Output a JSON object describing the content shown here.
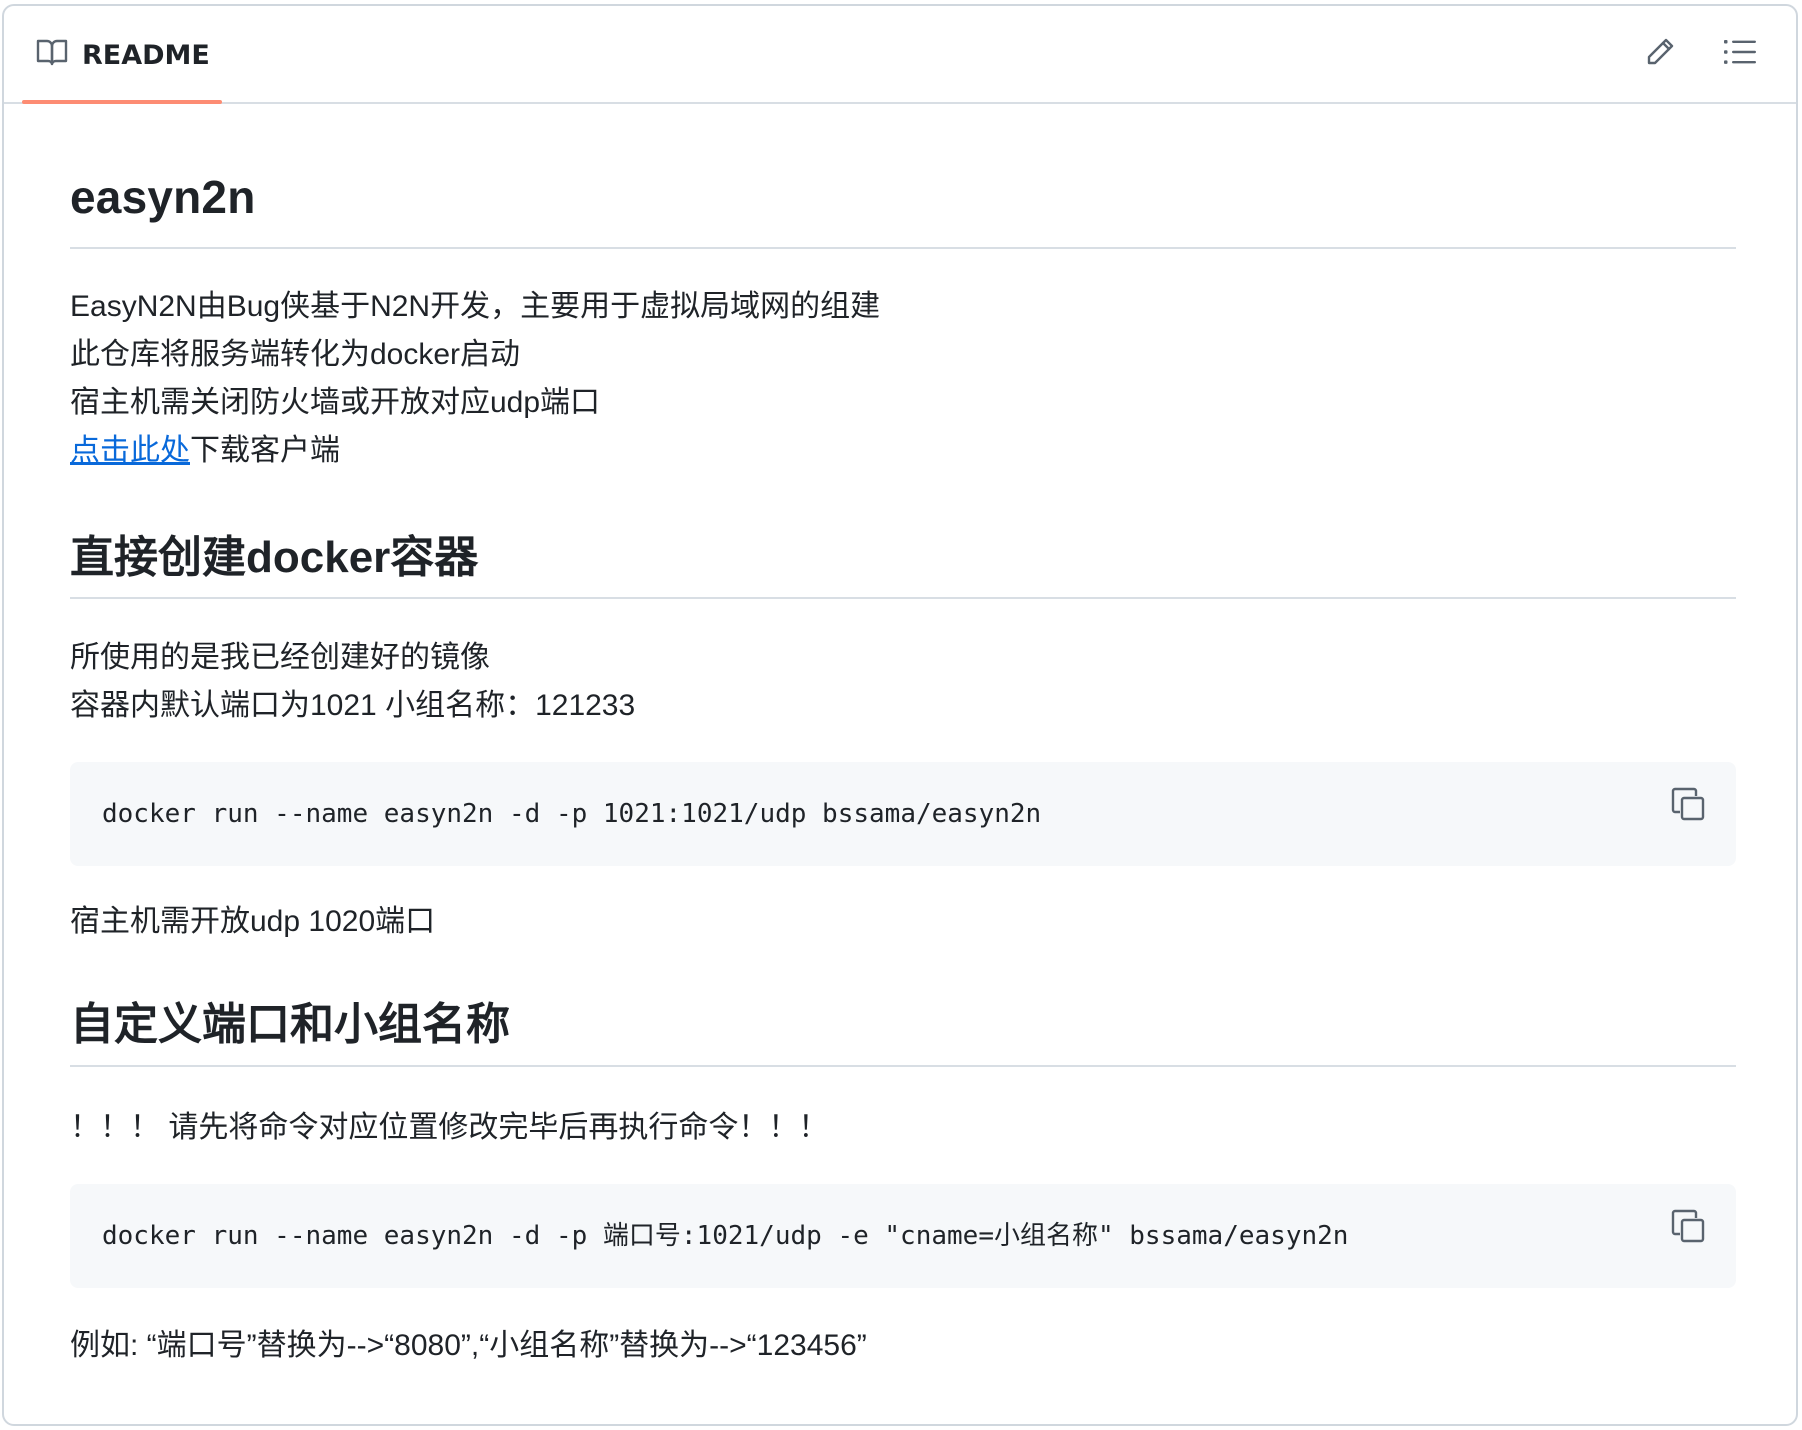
{
  "header": {
    "tab_label": "README"
  },
  "readme": {
    "title": "easyn2n",
    "intro_lines": [
      "EasyN2N由Bug侠基于N2N开发，主要用于虚拟局域网的组建",
      "此仓库将服务端转化为docker启动",
      "宿主机需关闭防火墙或开放对应udp端口"
    ],
    "download": {
      "link_text": "点击此处",
      "suffix": "下载客户端"
    },
    "section1": {
      "heading": "直接创建docker容器",
      "lines": [
        "所使用的是我已经创建好的镜像",
        "容器内默认端口为1021 小组名称：121233"
      ],
      "code": "docker run --name easyn2n -d -p 1021:1021/udp bssama/easyn2n",
      "note": "宿主机需开放udp 1020端口"
    },
    "section2": {
      "heading": "自定义端口和小组名称",
      "warning": "！！！ 请先将命令对应位置修改完毕后再执行命令！！！",
      "code": "docker run --name easyn2n -d -p 端口号:1021/udp -e \"cname=小组名称\" bssama/easyn2n",
      "example": "例如: “端口号”替换为-->“8080”,“小组名称”替换为-->“123456”"
    }
  },
  "colors": {
    "link": "#0969da",
    "tab_underline": "#fd8c73",
    "code_bg": "#f6f8fa"
  }
}
